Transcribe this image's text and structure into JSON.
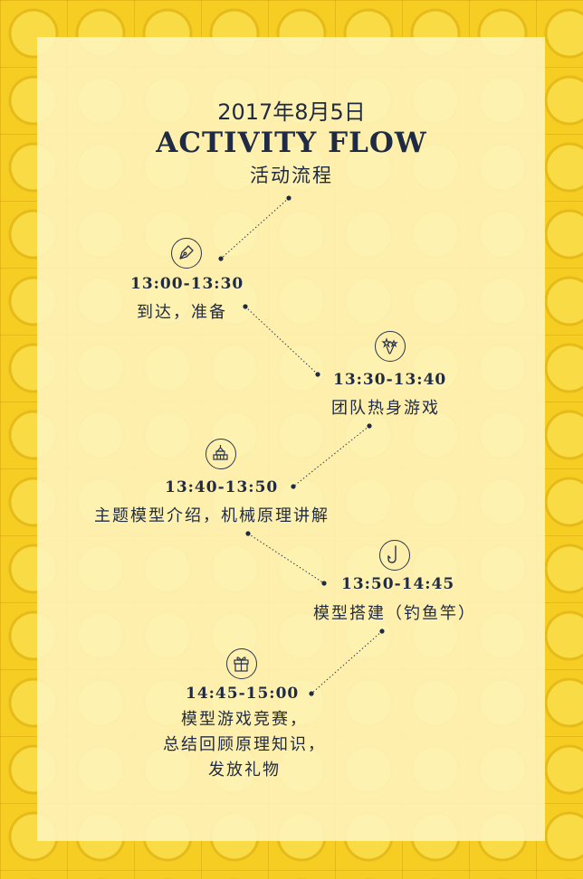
{
  "header": {
    "date": "2017年8月5日",
    "title": "ACTIVITY FLOW",
    "subtitle": "活动流程"
  },
  "events": [
    {
      "time": "13:00-13:30",
      "description": "到达，准备",
      "icon": "fountain-pen-icon"
    },
    {
      "time": "13:30-13:40",
      "description": "团队热身游戏",
      "icon": "sparkles-icon"
    },
    {
      "time": "13:40-13:50",
      "description": "主题模型介绍，机械原理讲解",
      "icon": "building-model-icon"
    },
    {
      "time": "13:50-14:45",
      "description": "模型搭建（钓鱼竿）",
      "icon": "fishing-hook-icon"
    },
    {
      "time": "14:45-15:00",
      "description_lines": [
        "模型游戏竞赛，",
        "总结回顾原理知识，",
        "发放礼物"
      ],
      "icon": "gift-icon"
    }
  ],
  "colors": {
    "background": "#f6cd22",
    "panel": "#fff6c4",
    "text": "#1f2a44"
  }
}
